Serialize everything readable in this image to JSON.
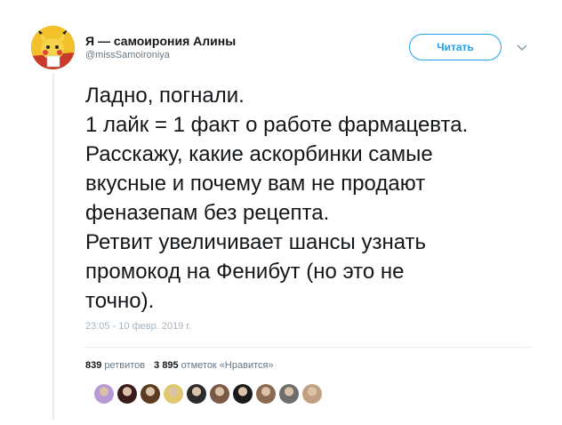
{
  "user": {
    "display_name": "Я — самоирония Алины",
    "handle": "@missSamoironiya",
    "avatar_icon": "pikachu-avatar"
  },
  "follow_button": {
    "label": "Читать"
  },
  "menu_icon": "chevron-down-icon",
  "tweet": {
    "lines": [
      "Ладно, погнали.",
      "1 лайк = 1 факт о работе фармацевта.",
      "Расскажу, какие аскорбинки самые",
      "вкусные и почему вам не продают",
      "феназепам без рецепта.",
      "Ретвит увеличивает шансы узнать",
      "промокод на Фенибут (но это не",
      "точно)."
    ],
    "timestamp": "23:05 - 10 февр. 2019 г."
  },
  "stats": {
    "retweets_count": "839",
    "retweets_label": "ретвитов",
    "likes_count": "3 895",
    "likes_label": "отметок «Нравится»"
  },
  "likers": [
    {
      "icon": "liker-avatar-1",
      "color": "#b59ad6"
    },
    {
      "icon": "liker-avatar-2",
      "color": "#3a1a1a"
    },
    {
      "icon": "liker-avatar-3",
      "color": "#5a3b22"
    },
    {
      "icon": "liker-avatar-4",
      "color": "#e0c870"
    },
    {
      "icon": "liker-avatar-5",
      "color": "#2b2b2b"
    },
    {
      "icon": "liker-avatar-6",
      "color": "#7a5a45"
    },
    {
      "icon": "liker-avatar-7",
      "color": "#1a1a1a"
    },
    {
      "icon": "liker-avatar-8",
      "color": "#8a6a50"
    },
    {
      "icon": "liker-avatar-9",
      "color": "#6e6e6e"
    },
    {
      "icon": "liker-avatar-10",
      "color": "#c0a080"
    }
  ],
  "colors": {
    "accent": "#1da1f2",
    "text": "#14171a",
    "muted": "#657786",
    "divider": "#e6ecf0"
  }
}
